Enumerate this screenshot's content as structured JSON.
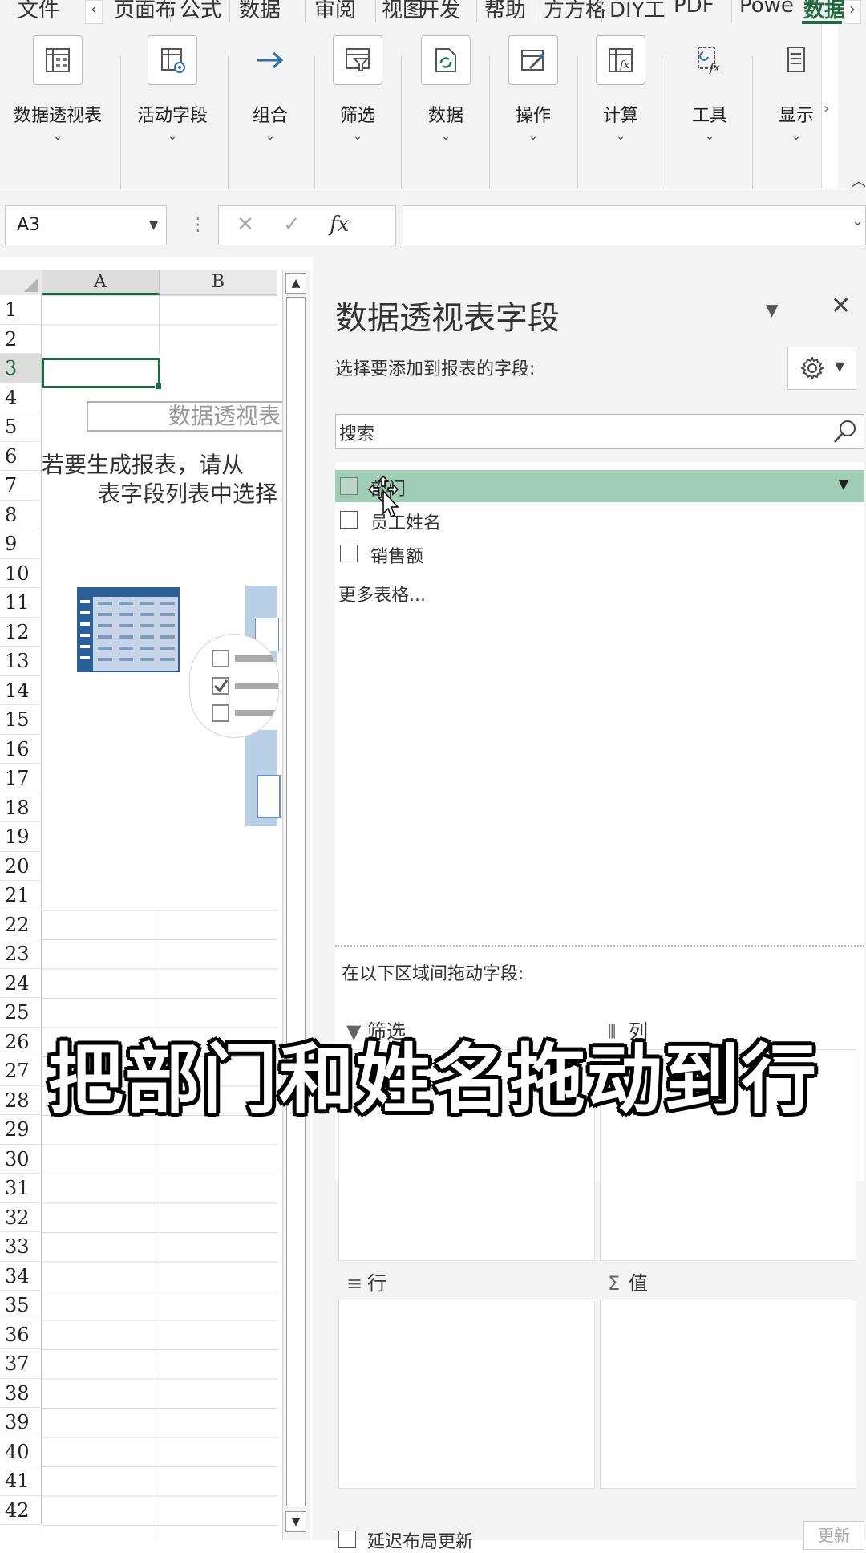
{
  "ribbon_tabs": [
    "文件",
    "页面布",
    "公式",
    "数据",
    "审阅",
    "视图",
    "开发",
    "帮助",
    "方方格",
    "DIY工",
    "PDF",
    "Powe",
    "数据"
  ],
  "ribbon_buttons": [
    {
      "label": "数据透视表",
      "icon": "pivot-table-icon"
    },
    {
      "label": "活动字段",
      "icon": "active-field-icon"
    },
    {
      "label": "组合",
      "icon": "group-arrow-icon"
    },
    {
      "label": "筛选",
      "icon": "filter-icon"
    },
    {
      "label": "数据",
      "icon": "refresh-data-icon"
    },
    {
      "label": "操作",
      "icon": "actions-icon"
    },
    {
      "label": "计算",
      "icon": "calculation-icon"
    },
    {
      "label": "工具",
      "icon": "tools-icon"
    },
    {
      "label": "显示",
      "icon": "show-icon"
    }
  ],
  "formula_bar": {
    "name_box": "A3",
    "cancel": "✕",
    "enter": "✓",
    "fx": "fx",
    "value": ""
  },
  "sheet": {
    "columns": [
      "A",
      "B"
    ],
    "rows": [
      "1",
      "2",
      "3",
      "4",
      "5",
      "6",
      "7",
      "8",
      "9",
      "10",
      "11",
      "12",
      "13",
      "14",
      "15",
      "16",
      "17",
      "18",
      "19",
      "20",
      "21",
      "22",
      "23",
      "24",
      "25",
      "26",
      "27",
      "28",
      "29",
      "30",
      "31",
      "32",
      "33",
      "34",
      "35",
      "36",
      "37",
      "38",
      "39",
      "40",
      "41",
      "42"
    ],
    "selected_cell": "A3",
    "pivot_placeholder_title": "数据透视表",
    "pivot_hint_line1": "若要生成报表，请从",
    "pivot_hint_line2": "表字段列表中选择"
  },
  "pane": {
    "title": "数据透视表字段",
    "subtitle": "选择要添加到报表的字段:",
    "search_placeholder": "搜索",
    "fields": [
      {
        "label": "部门",
        "checked": false,
        "highlighted": true
      },
      {
        "label": "员工姓名",
        "checked": false,
        "highlighted": false
      },
      {
        "label": "销售额",
        "checked": false,
        "highlighted": false
      }
    ],
    "more_tables": "更多表格...",
    "drag_label": "在以下区域间拖动字段:",
    "areas": {
      "filter": "筛选",
      "columns": "列",
      "rows": "行",
      "values": "值"
    },
    "defer_update": "延迟布局更新",
    "update_button": "更新"
  },
  "caption": "把部门和姓名拖动到行",
  "colors": {
    "accent": "#1e6b3e",
    "field_highlight": "#9fceb5",
    "ribbon_bg": "#f3f3f3"
  }
}
